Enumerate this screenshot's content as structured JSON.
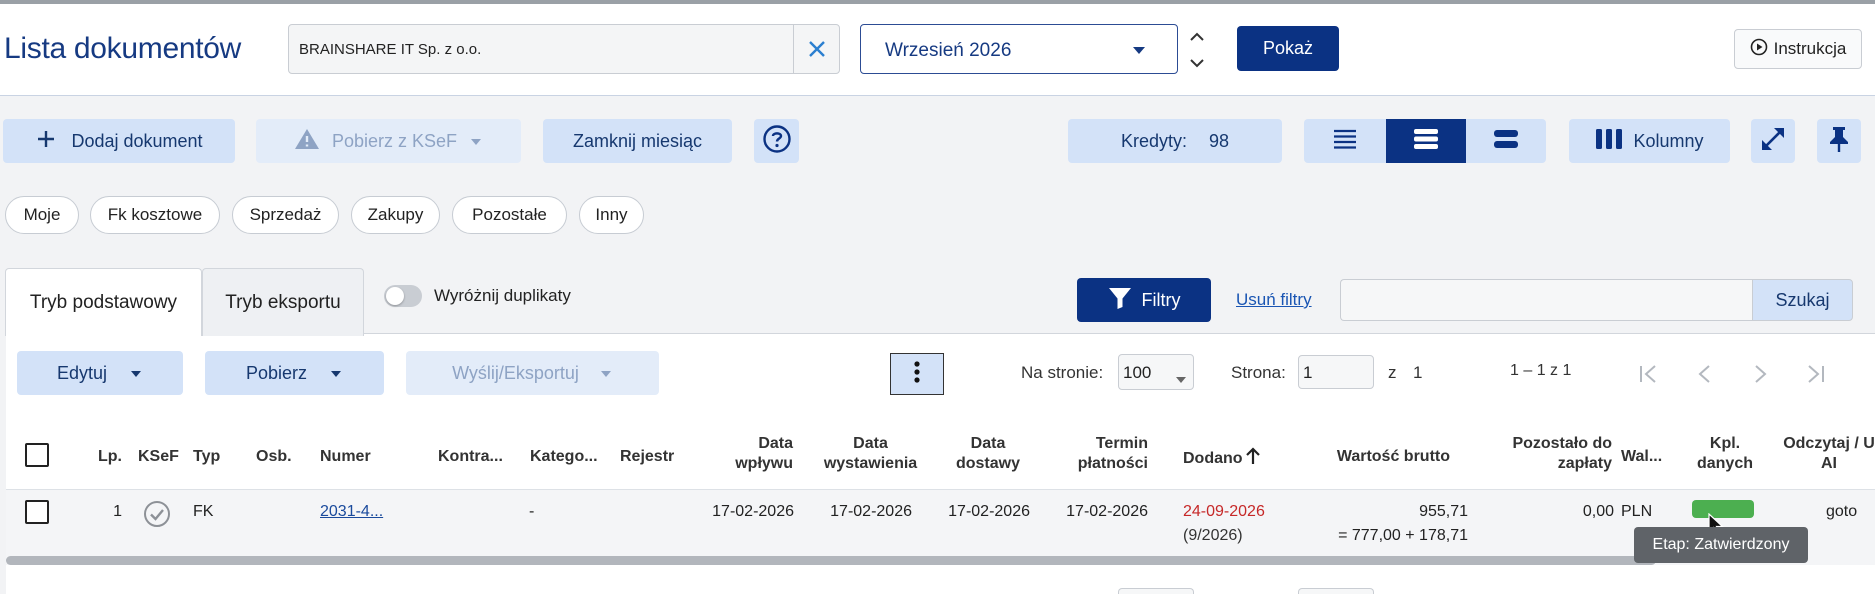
{
  "header": {
    "title": "Lista dokumentów",
    "company_value": "BRAINSHARE IT Sp. z o.o.",
    "month_value": "Wrzesień 2026",
    "show_label": "Pokaż",
    "instr_label": "Instrukcja"
  },
  "toolbar": {
    "add_label": "Dodaj dokument",
    "ksef_label": "Pobierz z KSeF",
    "close_month_label": "Zamknij miesiąc",
    "credits_label": "Kredyty:",
    "credits_value": "98",
    "columns_label": "Kolumny"
  },
  "chips": [
    "Moje",
    "Fk kosztowe",
    "Sprzedaż",
    "Zakupy",
    "Pozostałe",
    "Inny"
  ],
  "tabs": {
    "basic": "Tryb podstawowy",
    "export": "Tryb eksportu",
    "duplicates_label": "Wyróżnij duplikaty",
    "filters_label": "Filtry",
    "clear_filters_label": "Usuń filtry",
    "search_placeholder": "",
    "search_label": "Szukaj"
  },
  "actions": {
    "edit_label": "Edytuj",
    "download_label": "Pobierz",
    "send_label": "Wyślij/Eksportuj",
    "per_page_label": "Na stronie:",
    "per_page_value": "100",
    "page_label": "Strona:",
    "page_value": "1",
    "of_label": "z",
    "total_pages": "1",
    "range_label": "1 – 1 z 1"
  },
  "table": {
    "headers": {
      "lp": "Lp.",
      "ksef": "KSeF",
      "typ": "Typ",
      "osb": "Osb.",
      "numer": "Numer",
      "kontra": "Kontra...",
      "katego": "Katego...",
      "rejestr": "Rejestr",
      "data_wplywu_1": "Data",
      "data_wplywu_2": "wpływu",
      "data_wyst_1": "Data",
      "data_wyst_2": "wystawienia",
      "data_dost_1": "Data",
      "data_dost_2": "dostawy",
      "termin_1": "Termin",
      "termin_2": "płatności",
      "dodano": "Dodano",
      "wartosc": "Wartość brutto",
      "pozostalo_1": "Pozostało do",
      "pozostalo_2": "zapłaty",
      "waluta": "Wal...",
      "kpl_1": "Kpl.",
      "kpl_2": "danych",
      "odczytaj_1": "Odczytaj / U",
      "odczytaj_2": "AI"
    },
    "row": {
      "lp": "1",
      "typ": "FK",
      "numer": "2031-4...",
      "kategoria": "-",
      "data_wplywu": "17-02-2026",
      "data_wystawienia": "17-02-2026",
      "data_dostawy": "17-02-2026",
      "termin": "17-02-2026",
      "dodano": "24-09-2026",
      "dodano_sub": "(9/2026)",
      "wartosc": "955,71",
      "wartosc_sub": "= 777,00 + 178,71",
      "pozostalo": "0,00",
      "waluta": "PLN",
      "kpl_fill": 1.0,
      "odczytaj": "goto"
    },
    "tooltip": "Etap: Zatwierdzony"
  },
  "colors": {
    "brand": "#0b3283",
    "accent_light": "#d3e2f8",
    "added_date": "#c62828",
    "status_green": "#4caf50"
  }
}
